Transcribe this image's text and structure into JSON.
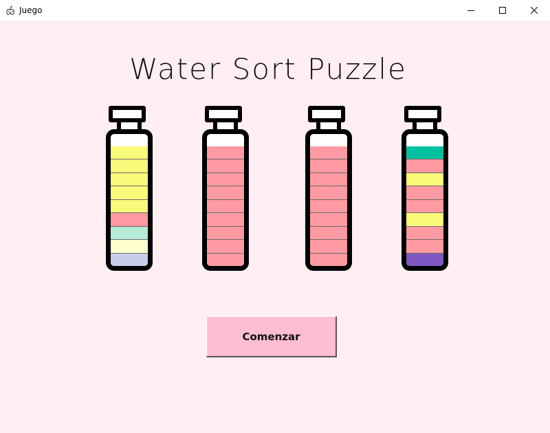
{
  "window": {
    "title": "Juego",
    "icon": "game-controller-icon",
    "controls": [
      "minimize-icon",
      "maximize-icon",
      "close-icon"
    ]
  },
  "game": {
    "title": "Water Sort Puzzle",
    "start_label": "Comenzar",
    "colors": {
      "yellow": "#f9f97a",
      "pink": "#ff9aa2",
      "mint": "#b5ead7",
      "cream": "#ffffd0",
      "periwinkle": "#c7ceea",
      "teal": "#00c19f",
      "purple": "#7e57c2",
      "background": "#ffeef2",
      "button": "#ffbdd4"
    },
    "bottles": [
      {
        "layers": [
          "yellow",
          "yellow",
          "yellow",
          "yellow",
          "yellow",
          "pink",
          "mint",
          "cream",
          "periwinkle"
        ]
      },
      {
        "layers": [
          "pink",
          "pink",
          "pink",
          "pink",
          "pink",
          "pink",
          "pink",
          "pink",
          "pink"
        ]
      },
      {
        "layers": [
          "pink",
          "pink",
          "pink",
          "pink",
          "pink",
          "pink",
          "pink",
          "pink",
          "pink"
        ]
      },
      {
        "layers": [
          "teal",
          "pink",
          "yellow",
          "pink",
          "pink",
          "yellow",
          "pink",
          "pink",
          "purple"
        ]
      }
    ]
  }
}
